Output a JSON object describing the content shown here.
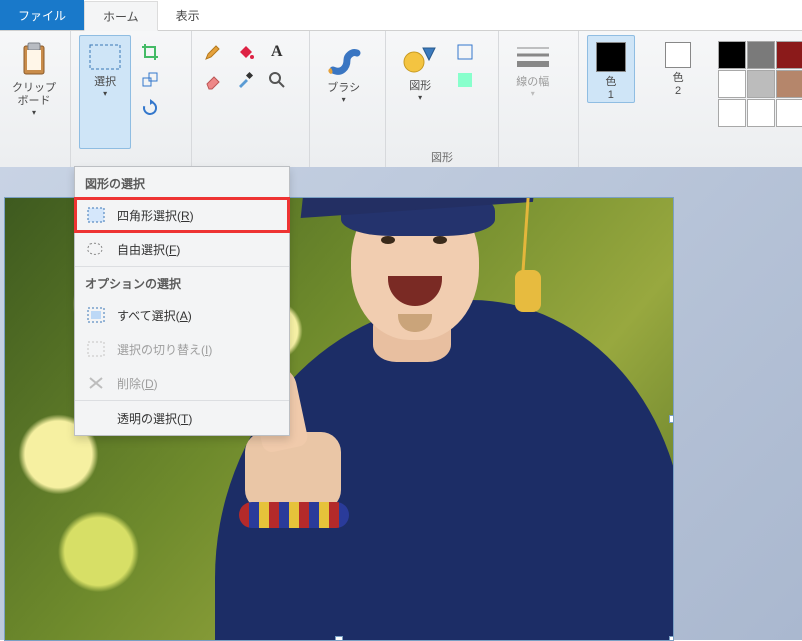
{
  "tabs": {
    "file": "ファイル",
    "home": "ホーム",
    "view": "表示"
  },
  "ribbon": {
    "clipboard": {
      "label": "クリップ\nボード"
    },
    "select": {
      "label": "選択"
    },
    "brushes": {
      "label": "ブラシ"
    },
    "shapes": {
      "label": "図形",
      "group_label": "図形"
    },
    "stroke": {
      "label": "線の幅"
    },
    "color1": {
      "label": "色\n1"
    },
    "color2": {
      "label": "色\n2"
    },
    "tools": {
      "crop": "crop",
      "resize": "resize",
      "rotate": "rotate",
      "pencil": "pencil",
      "fill": "fill",
      "text": "text",
      "eraser": "eraser",
      "picker": "picker",
      "zoom": "zoom"
    }
  },
  "dropdown": {
    "section_shapes": "図形の選択",
    "rect_select": {
      "label": "四角形選択(",
      "hot": "R",
      "tail": ")"
    },
    "free_select": {
      "label": "自由選択(",
      "hot": "F",
      "tail": ")"
    },
    "section_options": "オプションの選択",
    "select_all": {
      "label": "すべて選択(",
      "hot": "A",
      "tail": ")"
    },
    "invert": {
      "label": "選択の切り替え(",
      "hot": "I",
      "tail": ")"
    },
    "delete": {
      "label": "削除(",
      "hot": "D",
      "tail": ")"
    },
    "transparent": {
      "label": "透明の選択(",
      "hot": "T",
      "tail": ")"
    }
  },
  "colors": {
    "primary": "#000000",
    "secondary": "#ffffff",
    "palette": [
      "#000000",
      "#7a7a7a",
      "#8b1a1a",
      "#ffffff",
      "#bcbcbc",
      "#b5866b",
      "#ffffff",
      "#ffffff",
      "#ffffff"
    ]
  }
}
